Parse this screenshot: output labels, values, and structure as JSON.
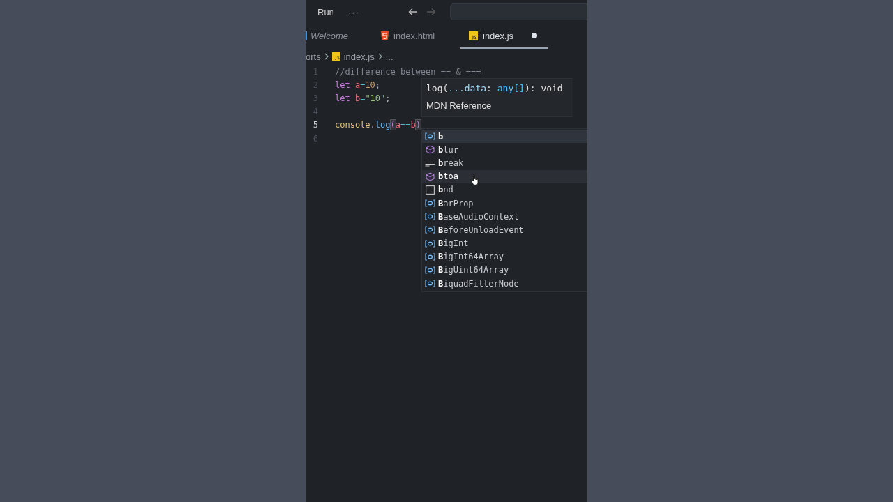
{
  "title_bar": {
    "menu_label": "Run",
    "more_label": "···",
    "back_enabled": true,
    "forward_enabled": false
  },
  "tabs": [
    {
      "label": "Welcome",
      "kind": "welcome",
      "selected": false,
      "modified": false,
      "italic": true
    },
    {
      "label": "index.html",
      "kind": "html",
      "selected": false,
      "modified": false,
      "italic": false
    },
    {
      "label": "index.js",
      "kind": "js",
      "selected": true,
      "modified": true,
      "italic": false
    }
  ],
  "breadcrumb": [
    {
      "label": "orts",
      "kind": "folder"
    },
    {
      "label": "index.js",
      "kind": "js"
    },
    {
      "label": "...",
      "kind": "symbol"
    }
  ],
  "editor": {
    "lines": [
      {
        "number": "1",
        "active": false,
        "tokens": [
          {
            "text": "//difference between == & ===",
            "kind": "comment"
          }
        ]
      },
      {
        "number": "2",
        "active": false,
        "tokens": [
          {
            "text": "let ",
            "kind": "keyword"
          },
          {
            "text": "a",
            "kind": "variable"
          },
          {
            "text": "=",
            "kind": "operator"
          },
          {
            "text": "10",
            "kind": "number"
          },
          {
            "text": ";",
            "kind": "plain"
          }
        ]
      },
      {
        "number": "3",
        "active": false,
        "tokens": [
          {
            "text": "let ",
            "kind": "keyword"
          },
          {
            "text": "b",
            "kind": "variable"
          },
          {
            "text": "=",
            "kind": "operator"
          },
          {
            "text": "\"10\"",
            "kind": "string"
          },
          {
            "text": ";",
            "kind": "plain"
          }
        ]
      },
      {
        "number": "4",
        "active": false
      },
      {
        "number": "5",
        "active": true,
        "tokens": [
          {
            "text": "console",
            "kind": "object"
          },
          {
            "text": ".",
            "kind": "plain"
          },
          {
            "text": "log",
            "kind": "function"
          },
          {
            "text": "(",
            "kind": "bracket"
          },
          {
            "text": "a",
            "kind": "variable"
          },
          {
            "text": "==",
            "kind": "operator"
          },
          {
            "text": "b",
            "kind": "variable"
          },
          {
            "text": ")",
            "kind": "bracket"
          }
        ]
      },
      {
        "number": "6",
        "active": false
      }
    ]
  },
  "hover": {
    "signature": [
      {
        "text": "log(",
        "kind": "plain"
      },
      {
        "text": "...data",
        "kind": "param"
      },
      {
        "text": ": ",
        "kind": "plain"
      },
      {
        "text": "any[]",
        "kind": "type"
      },
      {
        "text": "): void",
        "kind": "plain"
      }
    ],
    "link": "MDN Reference"
  },
  "suggestions": [
    {
      "match": "b",
      "kind": "variable",
      "selected": true,
      "hovered": false
    },
    {
      "match": "b",
      "rest": "lur",
      "kind": "method",
      "selected": false,
      "hovered": false
    },
    {
      "match": "b",
      "rest": "reak",
      "kind": "keyword",
      "selected": false,
      "hovered": false
    },
    {
      "match": "b",
      "rest": "toa",
      "kind": "method",
      "selected": false,
      "hovered": true
    },
    {
      "match": "b",
      "rest": "nd",
      "kind": "snippet",
      "selected": false,
      "hovered": false
    },
    {
      "match": "B",
      "rest": "arProp",
      "kind": "variable",
      "selected": false,
      "hovered": false
    },
    {
      "match": "B",
      "rest": "aseAudioContext",
      "kind": "variable",
      "selected": false,
      "hovered": false
    },
    {
      "match": "B",
      "rest": "eforeUnloadEvent",
      "kind": "variable",
      "selected": false,
      "hovered": false
    },
    {
      "match": "B",
      "rest": "igInt",
      "kind": "variable",
      "selected": false,
      "hovered": false
    },
    {
      "match": "B",
      "rest": "igInt64Array",
      "kind": "variable",
      "selected": false,
      "hovered": false
    },
    {
      "match": "B",
      "rest": "igUint64Array",
      "kind": "variable",
      "selected": false,
      "hovered": false
    },
    {
      "match": "B",
      "rest": "iquadFilterNode",
      "kind": "variable",
      "selected": false,
      "hovered": false
    }
  ]
}
